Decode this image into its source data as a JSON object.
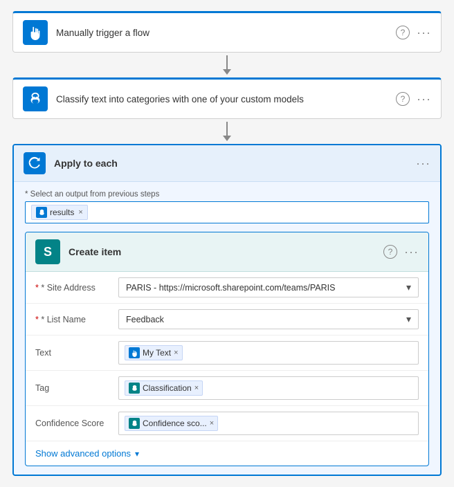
{
  "trigger": {
    "title": "Manually trigger a flow",
    "help": "?",
    "more": "···"
  },
  "classify": {
    "title": "Classify text into categories with one of your custom models",
    "help": "?",
    "more": "···"
  },
  "applyEach": {
    "title": "Apply to each",
    "more": "···",
    "selectOutputLabel": "* Select an output from previous steps",
    "outputToken": "results"
  },
  "createItem": {
    "title": "Create item",
    "help": "?",
    "more": "···",
    "iconLetter": "S",
    "fields": {
      "siteAddressLabel": "* Site Address",
      "siteAddressValue": "PARIS - https://microsoft.sharepoint.com/teams/PARIS",
      "listNameLabel": "* List Name",
      "listNameValue": "Feedback",
      "textLabel": "Text",
      "textToken": "My Text",
      "tagLabel": "Tag",
      "tagToken": "Classification",
      "confidenceLabel": "Confidence Score",
      "confidenceToken": "Confidence sco..."
    },
    "showAdvanced": "Show advanced options"
  }
}
